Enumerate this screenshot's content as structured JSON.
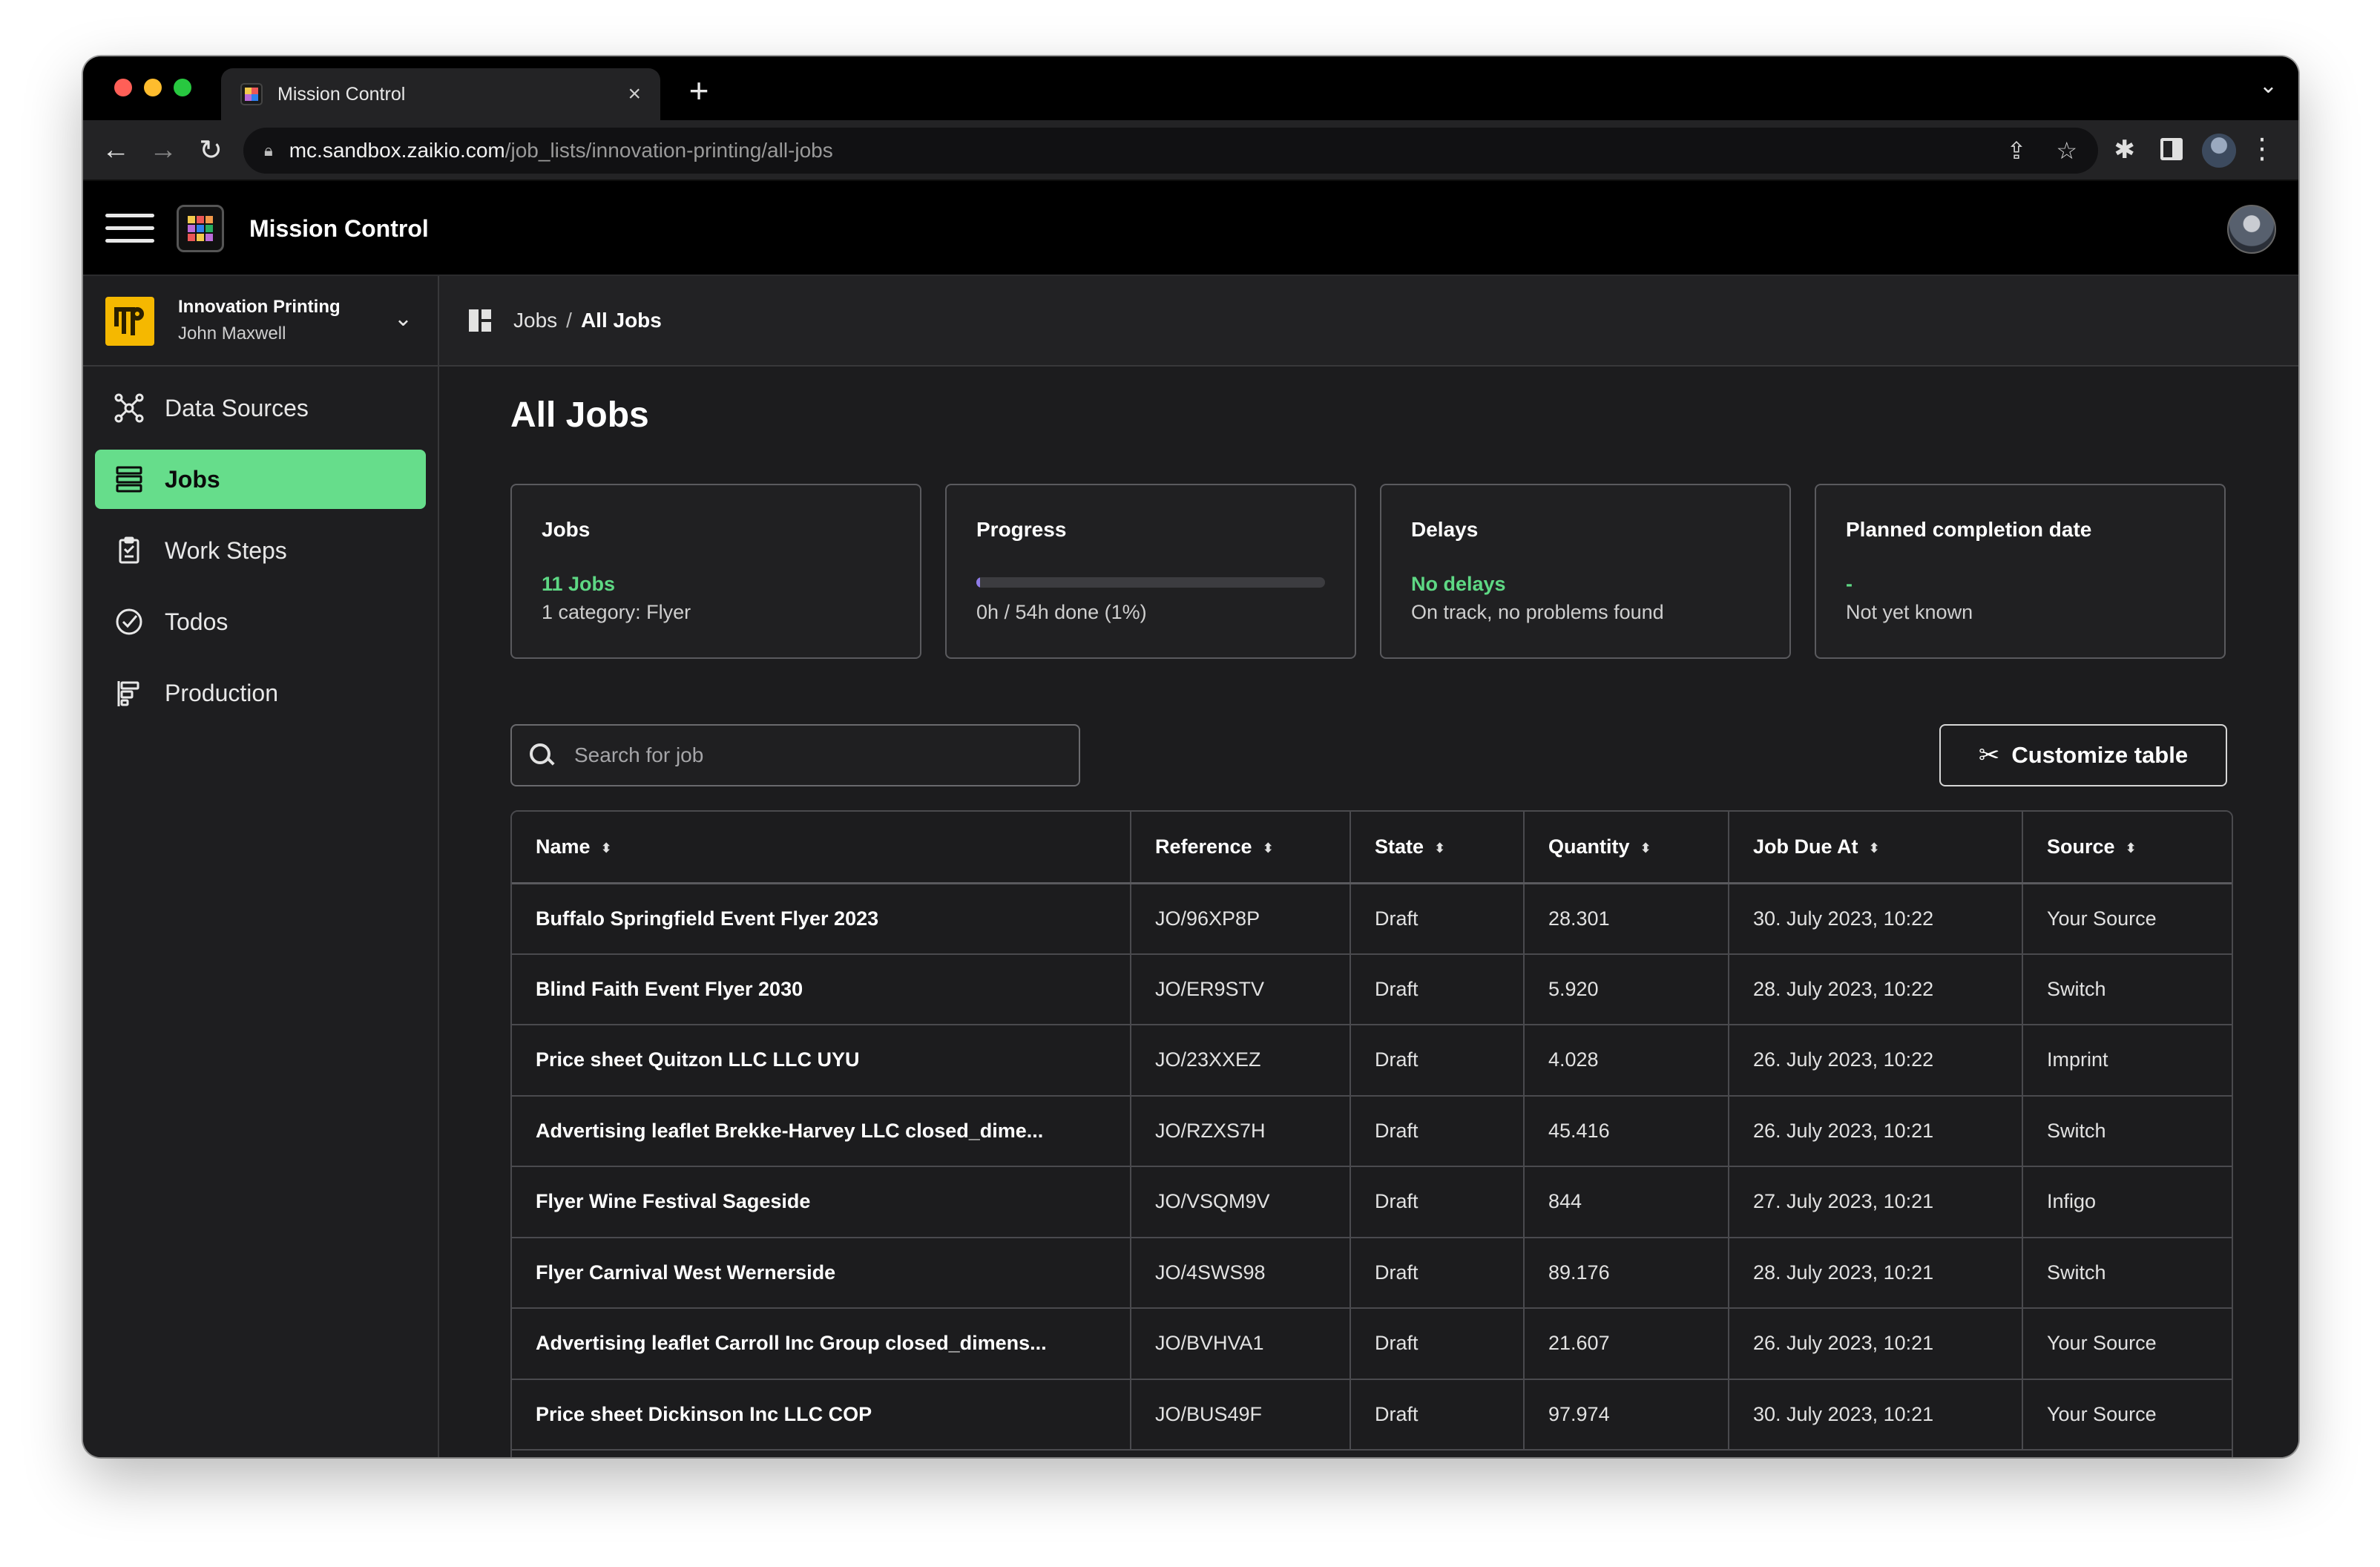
{
  "browser": {
    "tab_title": "Mission Control",
    "url_host": "mc.sandbox.zaikio.com",
    "url_path": "/job_lists/innovation-printing/all-jobs",
    "new_tab": "+",
    "close_tab": "×"
  },
  "app": {
    "title": "Mission Control"
  },
  "org": {
    "name": "Innovation Printing",
    "user": "John Maxwell"
  },
  "sidebar": {
    "items": [
      {
        "label": "Data Sources",
        "icon": "data-sources-icon"
      },
      {
        "label": "Jobs",
        "icon": "jobs-list-icon",
        "active": true
      },
      {
        "label": "Work Steps",
        "icon": "clipboard-check-icon"
      },
      {
        "label": "Todos",
        "icon": "check-circle-icon"
      },
      {
        "label": "Production",
        "icon": "production-icon"
      }
    ]
  },
  "breadcrumb": {
    "parent": "Jobs",
    "separator": "/",
    "current": "All Jobs"
  },
  "page": {
    "title": "All Jobs"
  },
  "cards": {
    "jobs": {
      "title": "Jobs",
      "value": "11 Jobs",
      "sub": "1 category: Flyer"
    },
    "progress": {
      "title": "Progress",
      "fraction": 0.01,
      "sub": "0h / 54h done (1%)"
    },
    "delays": {
      "title": "Delays",
      "value": "No delays",
      "sub": "On track, no problems found"
    },
    "completion": {
      "title": "Planned completion date",
      "value": "-",
      "sub": "Not yet known"
    }
  },
  "search": {
    "placeholder": "Search for job",
    "value": ""
  },
  "customize": {
    "label": "Customize table"
  },
  "table": {
    "columns": [
      "Name",
      "Reference",
      "State",
      "Quantity",
      "Job Due At",
      "Source"
    ],
    "rows": [
      [
        "Buffalo Springfield Event Flyer 2023",
        "JO/96XP8P",
        "Draft",
        "28.301",
        "30. July 2023, 10:22",
        "Your Source"
      ],
      [
        "Blind Faith Event Flyer 2030",
        "JO/ER9STV",
        "Draft",
        "5.920",
        "28. July 2023, 10:22",
        "Switch"
      ],
      [
        "Price sheet Quitzon LLC LLC UYU",
        "JO/23XXEZ",
        "Draft",
        "4.028",
        "26. July 2023, 10:22",
        "Imprint"
      ],
      [
        "Advertising leaflet Brekke-Harvey LLC closed_dime...",
        "JO/RZXS7H",
        "Draft",
        "45.416",
        "26. July 2023, 10:21",
        "Switch"
      ],
      [
        "Flyer Wine Festival Sageside",
        "JO/VSQM9V",
        "Draft",
        "844",
        "27. July 2023, 10:21",
        "Infigo"
      ],
      [
        "Flyer Carnival West Wernerside",
        "JO/4SWS98",
        "Draft",
        "89.176",
        "28. July 2023, 10:21",
        "Switch"
      ],
      [
        "Advertising leaflet Carroll Inc Group closed_dimens...",
        "JO/BVHVA1",
        "Draft",
        "21.607",
        "26. July 2023, 10:21",
        "Your Source"
      ],
      [
        "Price sheet Dickinson Inc LLC COP",
        "JO/BUS49F",
        "Draft",
        "97.974",
        "30. July 2023, 10:21",
        "Your Source"
      ]
    ]
  },
  "colors": {
    "accent_green": "#66dd8b",
    "status_green": "#5ed884",
    "progress_fill": "#8f7ce8"
  }
}
